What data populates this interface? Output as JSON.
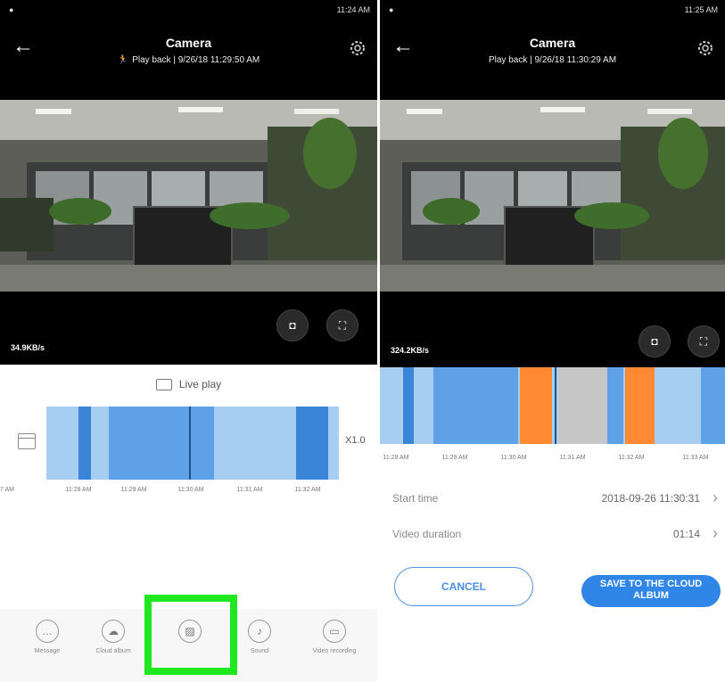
{
  "colors": {
    "accent": "#2f86e6",
    "timeline_light": "#a7cdf0",
    "timeline_mid": "#5fa1e6",
    "timeline_dark": "#3a85d8",
    "orange": "#ff8a33",
    "gray": "#c6c6c6",
    "highlight": "#1fe81f"
  },
  "left": {
    "status_right": "11:24 AM",
    "title": "Camera",
    "subtitle": "Play back | 9/26/18 11:29:50 AM",
    "speed": "34.9KB/s",
    "live_play": "Live play",
    "zoom_label": "X1.0",
    "ticks": [
      "7 AM",
      "11:28 AM",
      "11:29 AM",
      "11:30 AM",
      "11:31 AM",
      "11:32 AM"
    ],
    "toolbar": [
      {
        "label": "Message",
        "icon": "message-icon"
      },
      {
        "label": "Cloud album",
        "icon": "cloud-album-icon"
      },
      {
        "label": "",
        "icon": "picture-icon"
      },
      {
        "label": "Sound",
        "icon": "sound-icon"
      },
      {
        "label": "Video recording",
        "icon": "video-record-icon"
      }
    ]
  },
  "right": {
    "status_right": "11:25 AM",
    "title": "Camera",
    "subtitle": "Play back | 9/26/18 11:30:29 AM",
    "speed": "324.2KB/s",
    "ticks": [
      "11:28 AM",
      "11:29 AM",
      "11:30 AM",
      "11:31 AM",
      "11:32 AM",
      "11:33 AM"
    ],
    "rows": [
      {
        "label": "Start time",
        "value": "2018-09-26 11:30:31"
      },
      {
        "label": "Video duration",
        "value": "01:14"
      }
    ],
    "cancel": "CANCEL",
    "save": "SAVE TO THE CLOUD ALBUM"
  }
}
